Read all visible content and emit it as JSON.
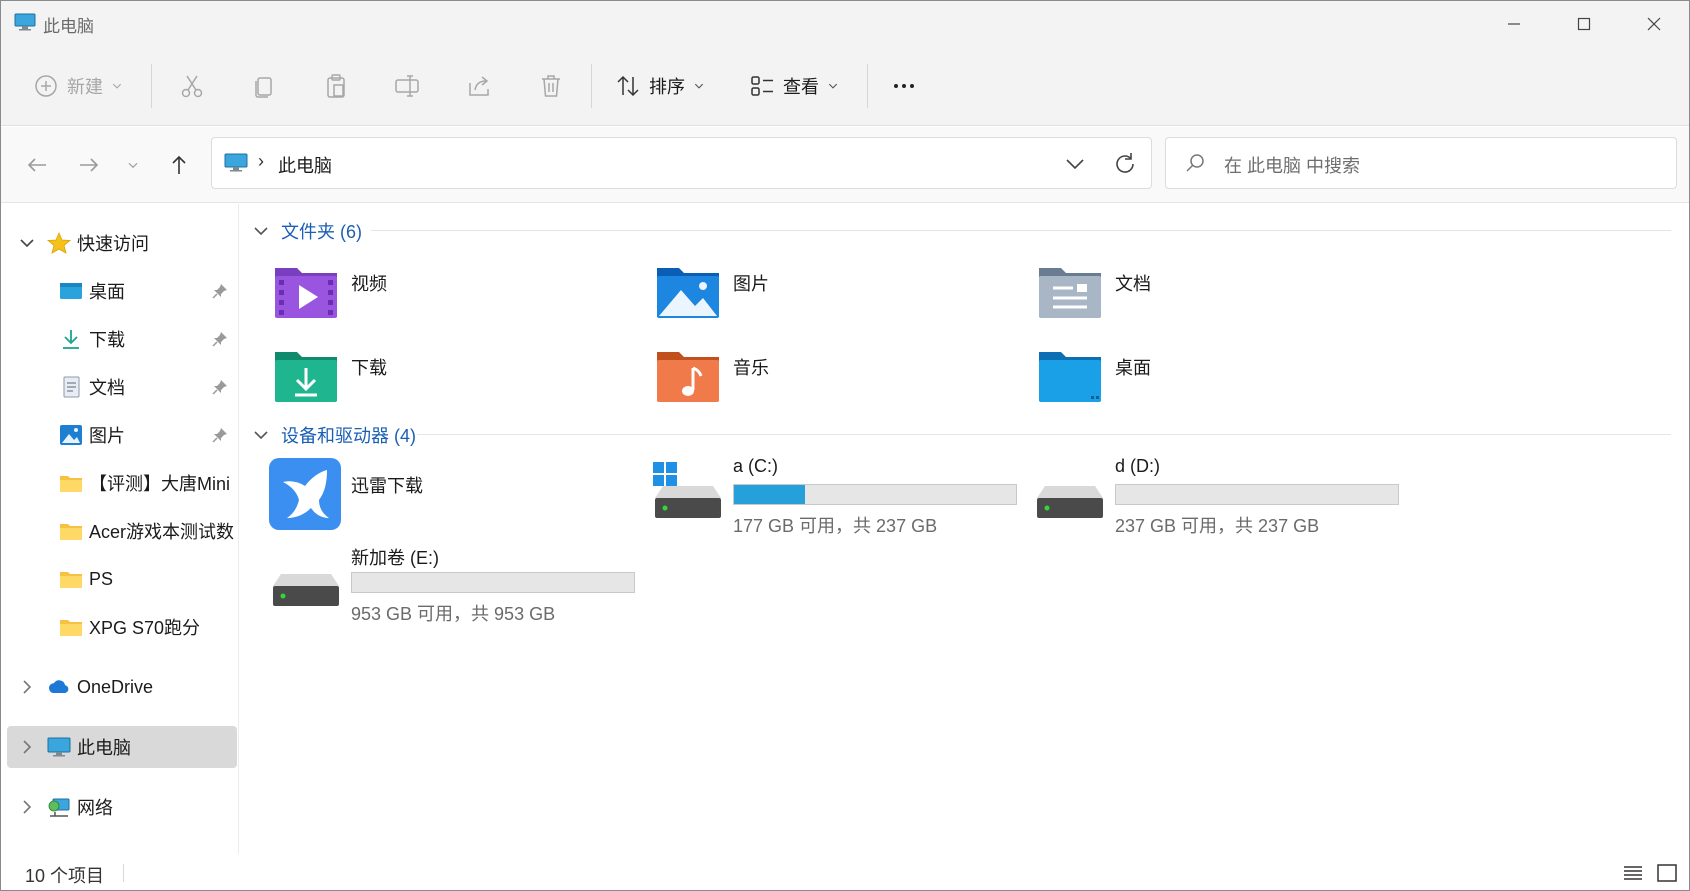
{
  "window": {
    "title": "此电脑"
  },
  "commands": {
    "new_label": "新建",
    "sort_label": "排序",
    "view_label": "查看",
    "more_label": "..."
  },
  "address": {
    "crumb": "此电脑",
    "search_placeholder": "在 此电脑 中搜索"
  },
  "sidebar": {
    "quick_access": "快速访问",
    "items": [
      {
        "label": "桌面",
        "icon": "desktop-icon",
        "pinned": true
      },
      {
        "label": "下载",
        "icon": "download-icon",
        "pinned": true
      },
      {
        "label": "文档",
        "icon": "document-icon",
        "pinned": true
      },
      {
        "label": "图片",
        "icon": "pictures-icon",
        "pinned": true
      },
      {
        "label": "【评测】大唐Mini",
        "icon": "folder-icon",
        "pinned": false
      },
      {
        "label": "Acer游戏本测试数",
        "icon": "folder-icon",
        "pinned": false
      },
      {
        "label": "PS",
        "icon": "folder-icon",
        "pinned": false
      },
      {
        "label": "XPG S70跑分",
        "icon": "folder-icon",
        "pinned": false
      }
    ],
    "onedrive": "OneDrive",
    "this_pc": "此电脑",
    "network": "网络"
  },
  "folders": {
    "header": "文件夹 (6)",
    "items": [
      {
        "label": "视频",
        "icon": "videos-folder-icon"
      },
      {
        "label": "图片",
        "icon": "pictures-folder-icon"
      },
      {
        "label": "文档",
        "icon": "documents-folder-icon"
      },
      {
        "label": "下载",
        "icon": "downloads-folder-icon"
      },
      {
        "label": "音乐",
        "icon": "music-folder-icon"
      },
      {
        "label": "桌面",
        "icon": "desktop-folder-icon"
      }
    ]
  },
  "devices": {
    "header": "设备和驱动器 (4)",
    "app": {
      "label": "迅雷下载",
      "icon": "xunlei-icon"
    },
    "drives": [
      {
        "name": "a (C:)",
        "usage": "177 GB 可用，共 237 GB",
        "used_fraction": 0.253,
        "system": true
      },
      {
        "name": "d (D:)",
        "usage": "237 GB 可用，共 237 GB",
        "used_fraction": 0.0,
        "system": false
      },
      {
        "name": "新加卷 (E:)",
        "usage": "953 GB 可用，共 953 GB",
        "used_fraction": 0.0,
        "system": false
      }
    ]
  },
  "status": {
    "count": "10 个项目"
  },
  "colors": {
    "accent": "#26a0da",
    "group_header": "#1a5fb4",
    "selected_nav": "#d9d9d9"
  }
}
